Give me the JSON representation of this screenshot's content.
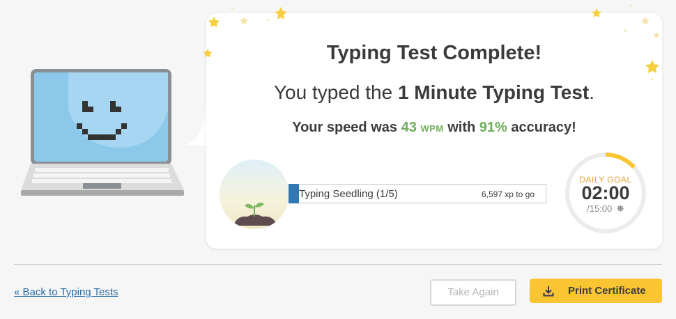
{
  "result": {
    "title": "Typing Test Complete!",
    "subtitle_pre": "You typed the ",
    "subtitle_test": "1 Minute Typing Test",
    "subtitle_post": ".",
    "speed_pre": "Your speed was ",
    "wpm": "43",
    "wpm_unit": "WPM",
    "speed_mid": " with ",
    "accuracy": "91%",
    "speed_post": " accuracy!"
  },
  "level": {
    "name": "Typing Seedling (1/5)",
    "xp_to_go": "6,597 xp to go",
    "progress_fraction": 0.04
  },
  "daily_goal": {
    "label": "DAILY GOAL",
    "time": "02:00",
    "total": "/15:00",
    "progress_fraction": 0.133
  },
  "icons": {
    "settings": "gear-icon",
    "download": "download-icon",
    "stars": "star-icon",
    "laptop": "smiling-laptop-icon",
    "badge": "seedling-badge-icon"
  },
  "colors": {
    "accent_green": "#6fae5a",
    "progress_blue": "#2f7ab3",
    "goal_orange": "#f9c533",
    "button_yellow": "#f9c533",
    "link_blue": "#2b6aa6"
  },
  "footer": {
    "back_link": "« Back to Typing Tests",
    "take_again": "Take Again",
    "print_certificate": "Print Certificate"
  }
}
